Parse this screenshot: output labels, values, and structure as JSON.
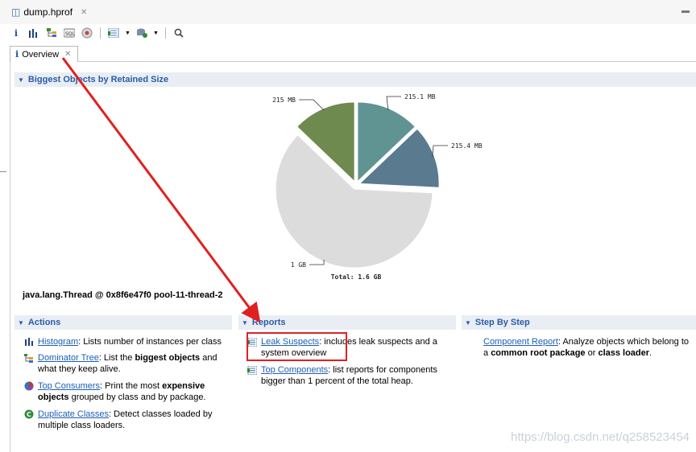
{
  "editor": {
    "file_tab": "dump.hprof"
  },
  "inner_tab": {
    "label": "Overview"
  },
  "chart_section": {
    "title": "Biggest Objects by Retained Size"
  },
  "chart_data": {
    "type": "pie",
    "slices": [
      {
        "label": "215.1 MB",
        "value": 215.1,
        "color": "#5f9492"
      },
      {
        "label": "215.4 MB",
        "value": 215.4,
        "color": "#5a7a90"
      },
      {
        "label": "1 GB",
        "value": 1024,
        "color": "#dcdcdc"
      },
      {
        "label": "215 MB",
        "value": 215,
        "color": "#6e8a4f"
      }
    ],
    "total": "Total: 1.6 GB"
  },
  "selected_object": "java.lang.Thread @ 0x8f6e47f0 pool-11-thread-2",
  "actions": {
    "title": "Actions",
    "items": [
      {
        "link": "Histogram",
        "text": ": Lists number of instances per class"
      },
      {
        "link": "Dominator Tree",
        "text_pre": ": List the ",
        "bold": "biggest objects",
        "text_post": " and what they keep alive."
      },
      {
        "link": "Top Consumers",
        "text_pre": ": Print the most ",
        "bold": "expensive objects",
        "text_post": " grouped by class and by package."
      },
      {
        "link": "Duplicate Classes",
        "text": ": Detect classes loaded by multiple class loaders."
      }
    ]
  },
  "reports": {
    "title": "Reports",
    "items": [
      {
        "link": "Leak Suspects",
        "text": ": includes leak suspects and a system overview"
      },
      {
        "link": "Top Components",
        "text": ": list reports for components bigger than 1 percent of the total heap."
      }
    ]
  },
  "step_by_step": {
    "title": "Step By Step",
    "items": [
      {
        "link": "Component Report",
        "text_pre": ": Analyze objects which belong to a ",
        "bold1": "common root package",
        "text_mid": " or ",
        "bold2": "class loader",
        "text_post": "."
      }
    ]
  },
  "watermark": "https://blog.csdn.net/q258523454",
  "colors": {
    "section_bg": "#e9eef4",
    "section_text": "#2a5ba8",
    "link": "#1a5fb4",
    "annotation_red": "#e02020"
  }
}
